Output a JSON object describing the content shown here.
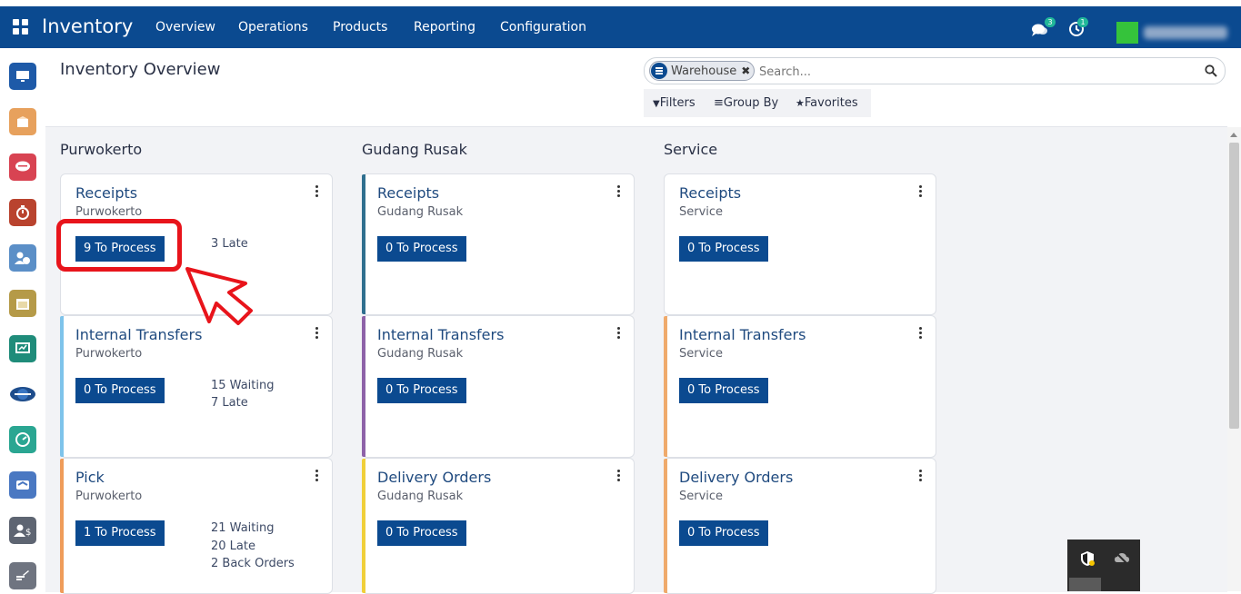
{
  "navbar": {
    "brand": "Inventory",
    "menu": [
      "Overview",
      "Operations",
      "Products",
      "Reporting",
      "Configuration"
    ],
    "chat_count": "3",
    "activity_count": "1",
    "bg_color": "#0b4a90"
  },
  "control_panel": {
    "title": "Inventory Overview",
    "facet_label": "Warehouse",
    "search_placeholder": "Search...",
    "filters_label": "Filters",
    "group_by_label": "Group By",
    "favorites_label": "Favorites"
  },
  "sidebar_icons": [
    {
      "name": "monitor-icon",
      "color": "#1e5aa8"
    },
    {
      "name": "box-icon",
      "color": "#e7a15d"
    },
    {
      "name": "chat-bubble-icon",
      "color": "#d84352"
    },
    {
      "name": "stopwatch-icon",
      "color": "#b9432e"
    },
    {
      "name": "employee-clock-icon",
      "color": "#5b8fc7"
    },
    {
      "name": "calendar-icon",
      "color": "#b59a48"
    },
    {
      "name": "presentation-icon",
      "color": "#1f8c7a"
    },
    {
      "name": "globe-icon",
      "color": "#1e4d8c"
    },
    {
      "name": "gauge-icon",
      "color": "#2aa692"
    },
    {
      "name": "handshake-icon",
      "color": "#4a78c2"
    },
    {
      "name": "user-dollar-icon",
      "color": "#5e6572"
    },
    {
      "name": "edit-icon",
      "color": "#6f7480"
    }
  ],
  "columns": [
    {
      "title": "Purwokerto",
      "cards": [
        {
          "title": "Receipts",
          "sub": "Purwokerto",
          "button": "9 To Process",
          "stats": [
            "3 Late"
          ],
          "color": ""
        },
        {
          "title": "Internal Transfers",
          "sub": "Purwokerto",
          "button": "0 To Process",
          "stats": [
            "15 Waiting",
            "7 Late"
          ],
          "color": "#7ec3ea"
        },
        {
          "title": "Pick",
          "sub": "Purwokerto",
          "button": "1 To Process",
          "stats": [
            "21 Waiting",
            "20 Late",
            "2 Back Orders"
          ],
          "color": "#ef9c5a"
        }
      ]
    },
    {
      "title": "Gudang Rusak",
      "cards": [
        {
          "title": "Receipts",
          "sub": "Gudang Rusak",
          "button": "0 To Process",
          "stats": [],
          "color": "#2f6f8f"
        },
        {
          "title": "Internal Transfers",
          "sub": "Gudang Rusak",
          "button": "0 To Process",
          "stats": [],
          "color": "#8e62a8"
        },
        {
          "title": "Delivery Orders",
          "sub": "Gudang Rusak",
          "button": "0 To Process",
          "stats": [],
          "color": "#f0cf3a"
        }
      ]
    },
    {
      "title": "Service",
      "cards": [
        {
          "title": "Receipts",
          "sub": "Service",
          "button": "0 To Process",
          "stats": [],
          "color": ""
        },
        {
          "title": "Internal Transfers",
          "sub": "Service",
          "button": "0 To Process",
          "stats": [],
          "color": "#efaa6c"
        },
        {
          "title": "Delivery Orders",
          "sub": "Service",
          "button": "0 To Process",
          "stats": [],
          "color": "#efaa6c"
        }
      ]
    }
  ]
}
